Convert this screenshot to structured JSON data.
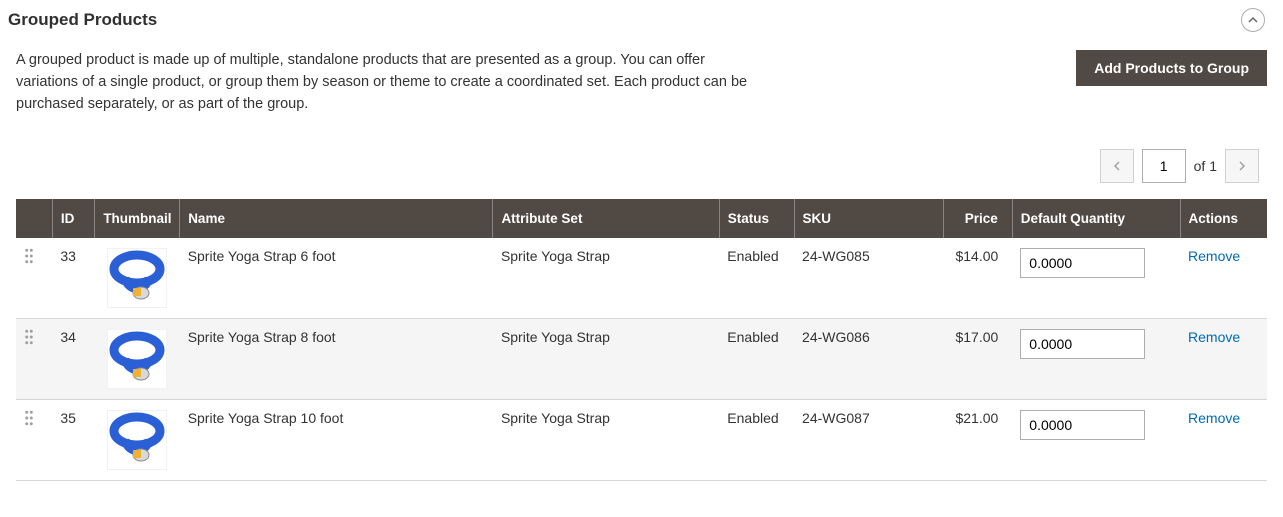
{
  "section": {
    "title": "Grouped Products",
    "description": "A grouped product is made up of multiple, standalone products that are presented as a group. You can offer variations of a single product, or group them by season or theme to create a coordinated set. Each product can be purchased separately, or as part of the group.",
    "add_button": "Add Products to Group"
  },
  "pager": {
    "current": "1",
    "of_label": "of 1"
  },
  "columns": {
    "id": "ID",
    "thumbnail": "Thumbnail",
    "name": "Name",
    "attribute_set": "Attribute Set",
    "status": "Status",
    "sku": "SKU",
    "price": "Price",
    "default_qty": "Default Quantity",
    "actions": "Actions"
  },
  "rows": [
    {
      "id": "33",
      "name": "Sprite Yoga Strap 6 foot",
      "attribute_set": "Sprite Yoga Strap",
      "status": "Enabled",
      "sku": "24-WG085",
      "price": "$14.00",
      "qty": "0.0000",
      "remove": "Remove"
    },
    {
      "id": "34",
      "name": "Sprite Yoga Strap 8 foot",
      "attribute_set": "Sprite Yoga Strap",
      "status": "Enabled",
      "sku": "24-WG086",
      "price": "$17.00",
      "qty": "0.0000",
      "remove": "Remove"
    },
    {
      "id": "35",
      "name": "Sprite Yoga Strap 10 foot",
      "attribute_set": "Sprite Yoga Strap",
      "status": "Enabled",
      "sku": "24-WG087",
      "price": "$21.00",
      "qty": "0.0000",
      "remove": "Remove"
    }
  ],
  "colors": {
    "thumbnail_strap": "#2b5fd6"
  }
}
